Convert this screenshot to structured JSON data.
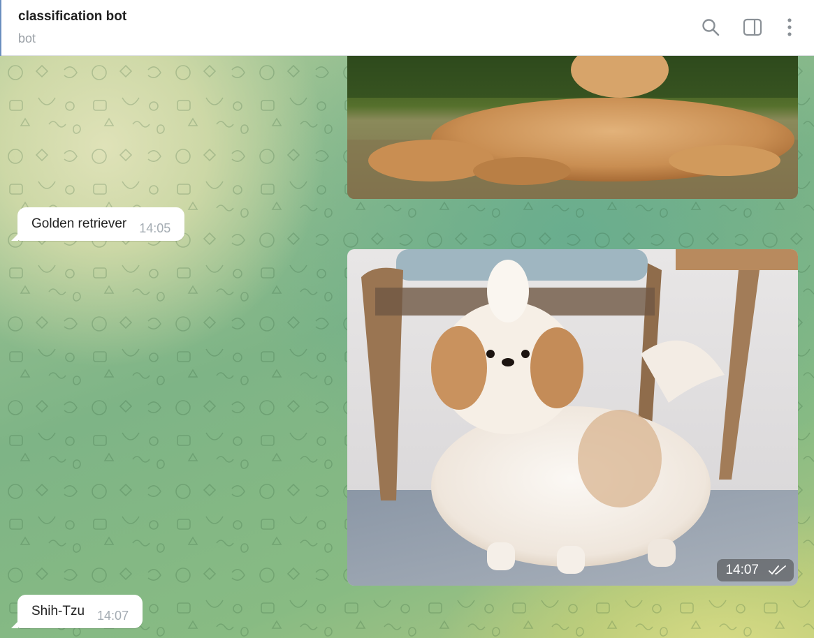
{
  "header": {
    "title": "classification bot",
    "subtitle": "bot",
    "icons": [
      "search-icon",
      "sidebar-toggle-icon",
      "more-vertical-icon"
    ]
  },
  "messages": [
    {
      "type": "photo",
      "subject": "golden retriever photo",
      "direction": "outgoing"
    },
    {
      "type": "text",
      "direction": "incoming",
      "text": "Golden retriever",
      "time": "14:05"
    },
    {
      "type": "photo",
      "subject": "shih tzu photo",
      "direction": "outgoing",
      "time": "14:07",
      "status": "read"
    },
    {
      "type": "text",
      "direction": "incoming",
      "text": "Shih-Tzu",
      "time": "14:07"
    }
  ],
  "colors": {
    "header_bg": "#ffffff",
    "bubble_bg": "#ffffff",
    "chat_green": "#7eb486",
    "timestamp": "#a4acb3"
  }
}
